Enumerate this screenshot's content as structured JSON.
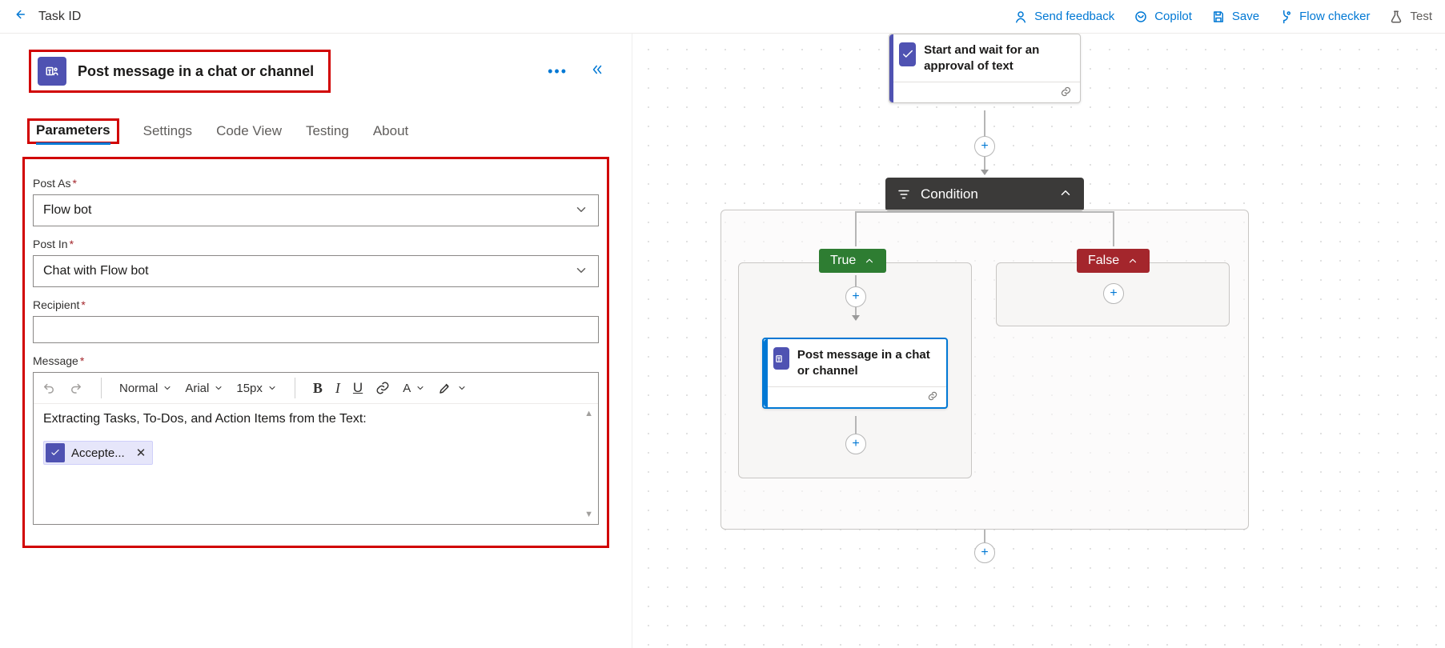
{
  "header": {
    "breadcrumb": "Task ID",
    "actions": {
      "feedback": "Send feedback",
      "copilot": "Copilot",
      "save": "Save",
      "flow_checker": "Flow checker",
      "test": "Test"
    }
  },
  "action_panel": {
    "title": "Post message in a chat or channel",
    "tabs": [
      "Parameters",
      "Settings",
      "Code View",
      "Testing",
      "About"
    ],
    "active_tab": "Parameters",
    "fields": {
      "post_as": {
        "label": "Post As",
        "value": "Flow bot"
      },
      "post_in": {
        "label": "Post In",
        "value": "Chat with Flow bot"
      },
      "recipient": {
        "label": "Recipient",
        "value": ""
      },
      "message": {
        "label": "Message"
      }
    },
    "editor": {
      "style_dd": "Normal",
      "font_dd": "Arial",
      "size_dd": "15px",
      "body_text": "Extracting Tasks, To-Dos, and Action Items from the Text:",
      "token_label": "Accepte..."
    }
  },
  "canvas": {
    "approval_card": "Start and wait for an approval of text",
    "condition_label": "Condition",
    "true_label": "True",
    "false_label": "False",
    "post_card": "Post message in a chat or channel"
  }
}
